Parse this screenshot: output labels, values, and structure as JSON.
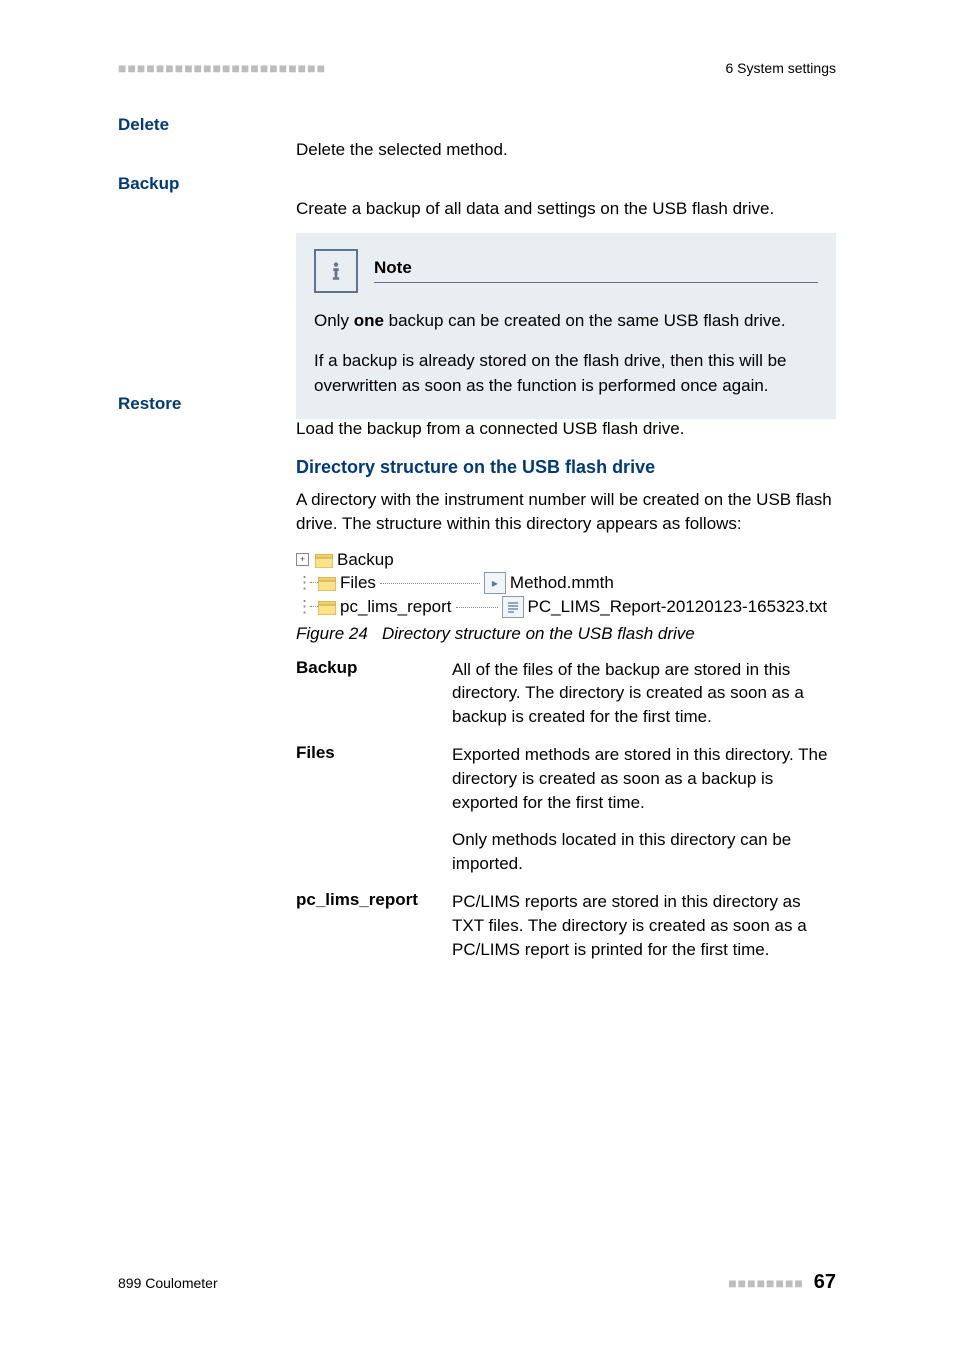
{
  "header": {
    "dashes": "■■■■■■■■■■■■■■■■■■■■■■",
    "section": "6 System settings"
  },
  "delete": {
    "label": "Delete",
    "text": "Delete the selected method."
  },
  "backup": {
    "label": "Backup",
    "text": "Create a backup of all data and settings on the USB flash drive.",
    "note": {
      "title": "Note",
      "line1_pre": "Only ",
      "line1_bold": "one",
      "line1_post": " backup can be created on the same USB flash drive.",
      "line2": "If a backup is already stored on the flash drive, then this will be overwritten as soon as the function is performed once again."
    }
  },
  "restore": {
    "label": "Restore",
    "text": "Load the backup from a connected USB flash drive."
  },
  "dir": {
    "heading": "Directory structure on the USB flash drive",
    "intro": "A directory with the instrument number will be created on the USB flash drive. The structure within this directory appears as follows:",
    "tree": {
      "backup": "Backup",
      "files": "Files",
      "pc_lims": "pc_lims_report",
      "method_file": "Method.mmth",
      "report_file": "PC_LIMS_Report-20120123-165323.txt"
    },
    "figure_label": "Figure 24",
    "figure_caption": "Directory structure on the USB flash drive",
    "defs": {
      "backup": {
        "term": "Backup",
        "body": "All of the files of the backup are stored in this directory. The directory is created as soon as a backup is created for the first time."
      },
      "files": {
        "term": "Files",
        "body": "Exported methods are stored in this directory. The directory is created as soon as a backup is exported for the first time.",
        "body2": "Only methods located in this directory can be imported."
      },
      "pc_lims": {
        "term": "pc_lims_report",
        "body": "PC/LIMS reports are stored in this directory as TXT files. The directory is created as soon as a PC/LIMS report is printed for the first time."
      }
    }
  },
  "footer": {
    "product": "899 Coulometer",
    "dashes": "■■■■■■■■",
    "page": "67"
  }
}
